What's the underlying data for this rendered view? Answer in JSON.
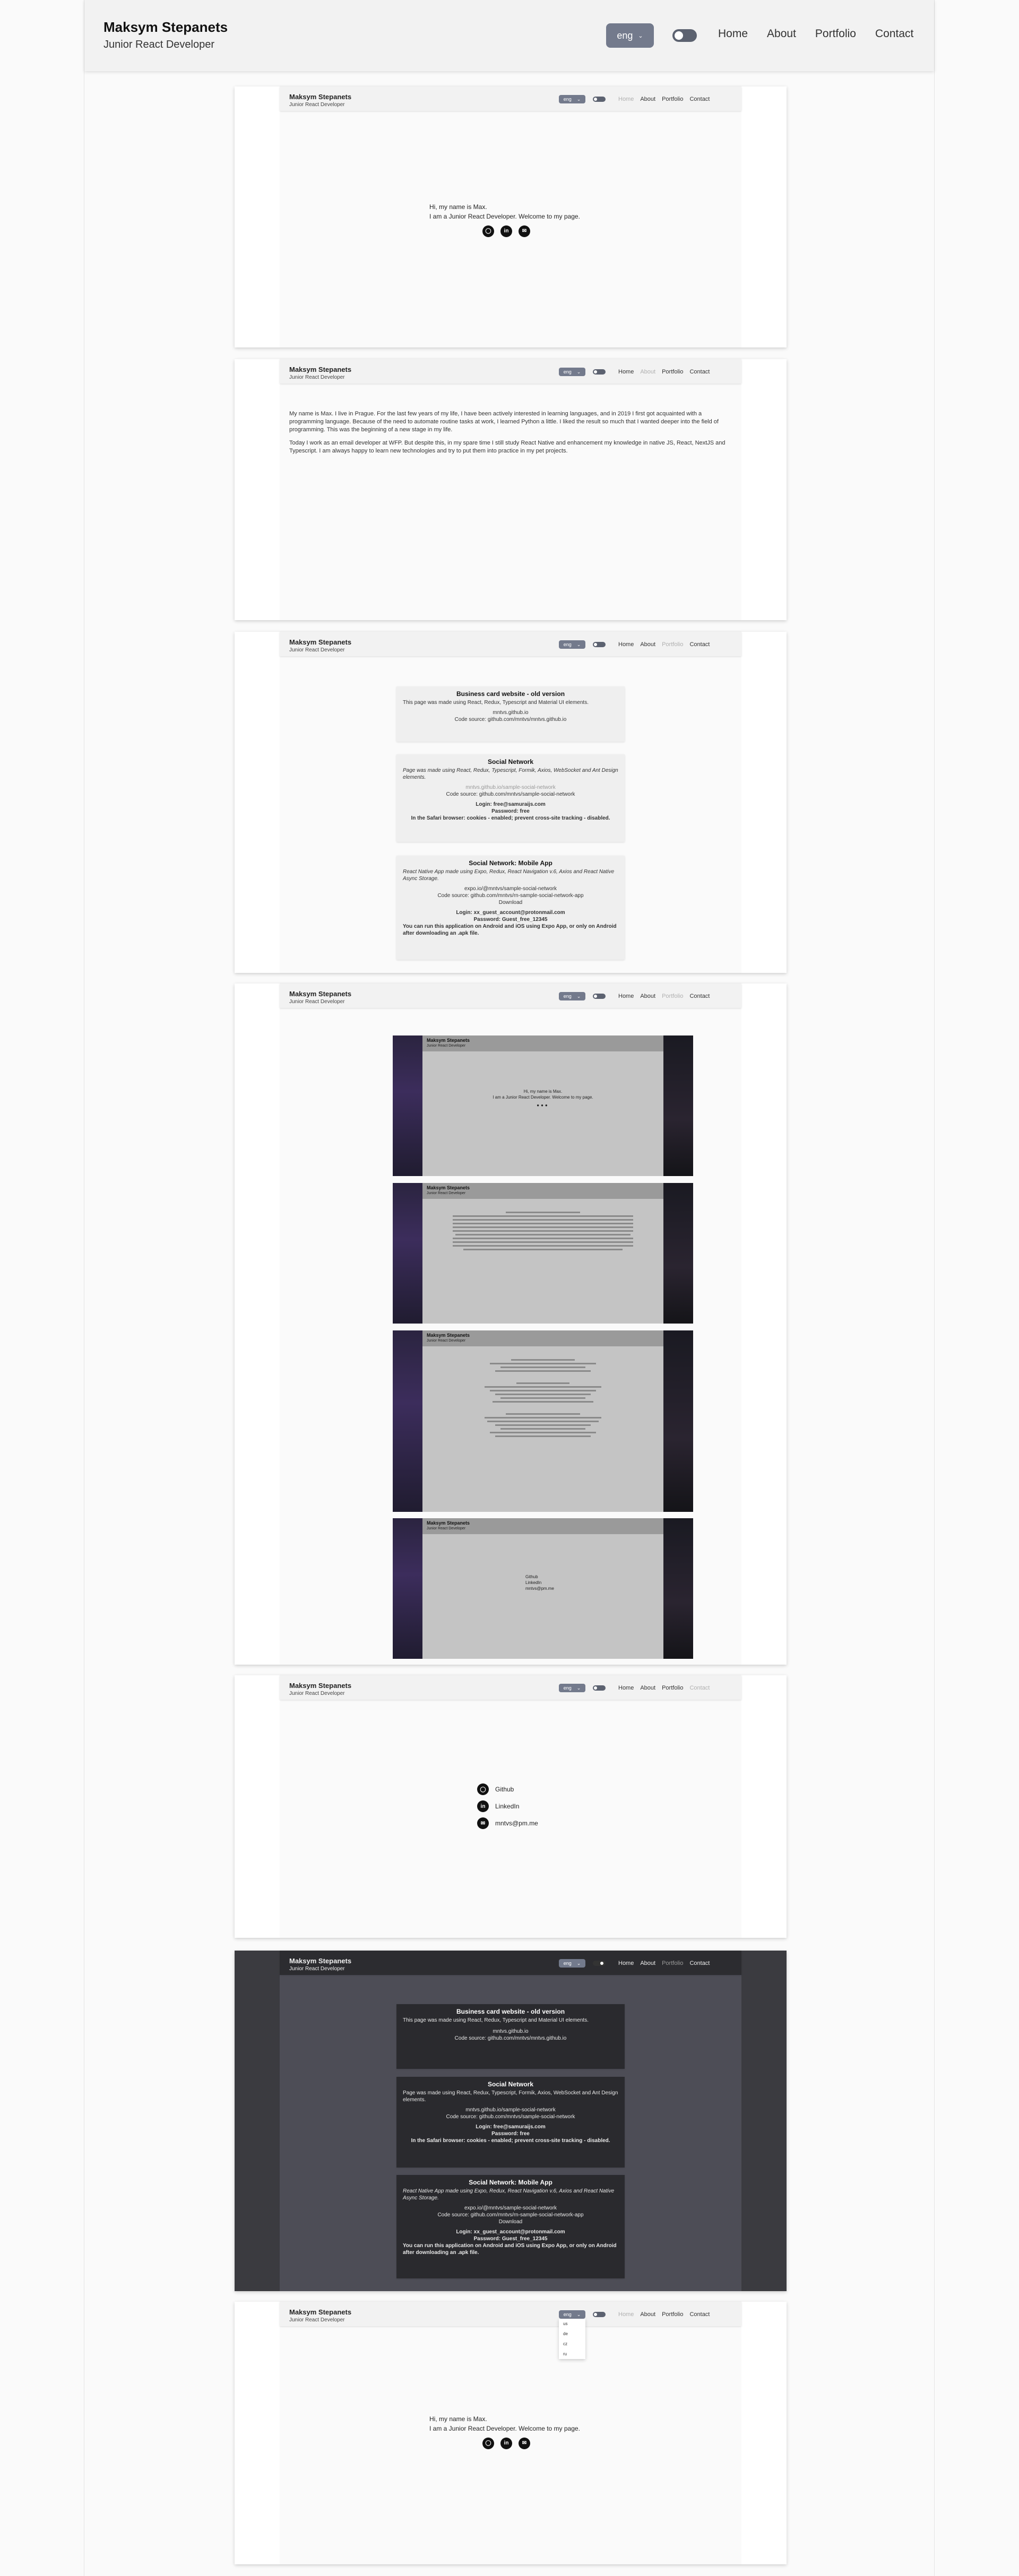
{
  "header": {
    "name": "Maksym Stepanets",
    "role": "Junior React Developer",
    "lang_value": "eng",
    "nav": [
      "Home",
      "About",
      "Portfolio",
      "Contact"
    ]
  },
  "home": {
    "line1": "Hi, my name is Max.",
    "line2": "I am a Junior React Developer. Welcome to my page."
  },
  "icons": {
    "github": "github-icon",
    "linkedin": "linkedin-icon",
    "email": "email-icon"
  },
  "about": {
    "p1": "My name is Max. I live in Prague. For the last few years of my life, I have been actively interested in learning languages, and in 2019 I first got acquainted with a programming language. Because of the need to automate routine tasks at work, I learned Python a little. I liked the result so much that I wanted deeper into the field of programming. This was the beginning of a new stage in my life.",
    "p2": "Today I work as an email developer at WFP. But despite this, in my spare time I still study React Native and enhancement my knowledge in native JS, React, NextJS and Typescript. I am always happy to learn new technologies and try to put them into practice in my pet projects."
  },
  "portfolio": {
    "card1": {
      "title": "Business card website - old version",
      "desc": "This page was made using React, Redux, Typescript and Material UI elements.",
      "link": "mntvs.github.io",
      "source": "Code source: github.com/mntvs/mntvs.github.io"
    },
    "card2": {
      "title": "Social Network",
      "desc": "Page was made using React, Redux, Typescript, Formik, Axios, WebSocket and Ant Design elements.",
      "link": "mntvs.github.io/sample-social-network",
      "source": "Code source: github.com/mntvs/sample-social-network",
      "login": "Login: free@samuraijs.com",
      "password": "Password: free",
      "note": "In the Safari browser: cookies - enabled; prevent cross-site tracking - disabled."
    },
    "card3": {
      "title": "Social Network: Mobile App",
      "desc": "React Native App made using Expo, Redux, React Navigation v.6, Axios and React Native Async Storage.",
      "link": "expo.io/@mntvs/sample-social-network",
      "source": "Code source: github.com/mntvs/rn-sample-social-network-app",
      "download": "Download",
      "login": "Login: xx_guest_account@protonmail.com",
      "password": "Password: Guest_free_12345",
      "note": "You can run this application on Android and iOS using Expo App, or only on Android after downloading an .apk file."
    }
  },
  "contact": {
    "items": [
      "Github",
      "LinkedIn",
      "mntvs@pm.me"
    ]
  },
  "dropdown": {
    "options": [
      "us",
      "de",
      "cz",
      "ru"
    ]
  },
  "colors": {
    "accent": "#737a8c",
    "header_bg": "#f2f2f2",
    "dark_bg": "#3b3b40"
  }
}
